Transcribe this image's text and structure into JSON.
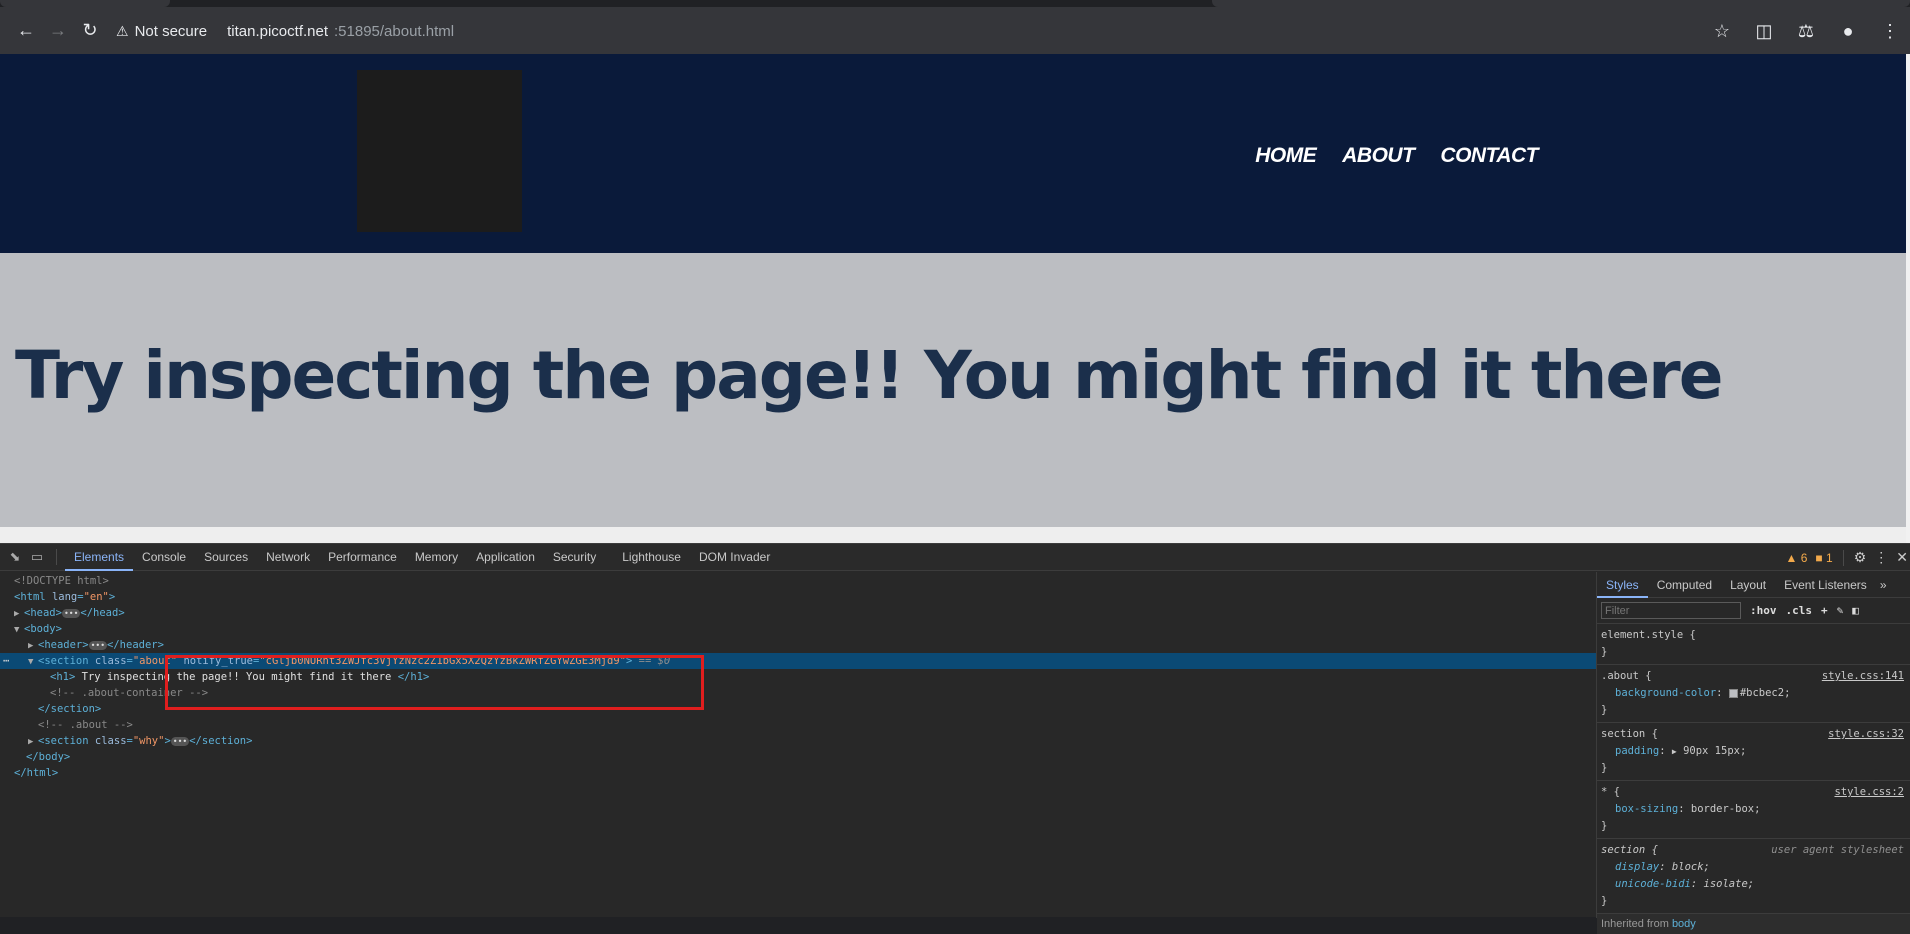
{
  "browser": {
    "security_label": "Not secure",
    "url_host": "titan.picoctf.net",
    "url_path": ":51895/about.html"
  },
  "site": {
    "nav": [
      "HOME",
      "ABOUT",
      "CONTACT"
    ],
    "heading": "Try inspecting the page!! You might find it there"
  },
  "devtools": {
    "tabs": [
      "Elements",
      "Console",
      "Sources",
      "Network",
      "Performance",
      "Memory",
      "Application",
      "Security",
      "Lighthouse",
      "DOM Invader"
    ],
    "warnings_count": "6",
    "issues_count": "1",
    "dom": {
      "doctype": "<!DOCTYPE html>",
      "html_open_tag": "<html",
      "html_lang_attr": "lang",
      "html_lang_val": "\"en\"",
      "head_open": "<head>",
      "head_close": "</head>",
      "body_open": "<body>",
      "header_open": "<header>",
      "header_close": "</header>",
      "section_open": "<section",
      "class_attr": "class",
      "about_val": "\"about\"",
      "notify_attr": "notify_true",
      "notify_val": "\"cGljb0NURnt3ZWJfc3VjYzNzc2Z1bGx5X2QzYzBkZWRfZGYwZGE3Mjd9\"",
      "tag_close": ">",
      "eq0": "== $0",
      "h1_open": "<h1>",
      "h1_text": " Try inspecting the page!! You might find it there ",
      "h1_close": "</h1>",
      "comment_container": "<!-- .about-container -->",
      "section_close": "</section>",
      "comment_about": "<!-- .about -->",
      "why_val": "\"why\"",
      "body_close": "</body>",
      "html_close": "</html>"
    },
    "styles": {
      "tabs": [
        "Styles",
        "Computed",
        "Layout",
        "Event Listeners"
      ],
      "filter_placeholder": "Filter",
      "hov": ":hov",
      "cls": ".cls",
      "rules": {
        "element_style": "element.style {",
        "about_selector": ".about {",
        "about_src": "style.css:141",
        "about_prop": "background-color",
        "about_value": "#bcbec2;",
        "section_selector": "section {",
        "section_src": "style.css:32",
        "section_prop": "padding",
        "section_value": "90px 15px;",
        "star_selector": "* {",
        "star_src": "style.css:2",
        "star_prop": "box-sizing",
        "star_value": "border-box;",
        "ua_selector": "section {",
        "ua_src": "user agent stylesheet",
        "ua_prop1": "display",
        "ua_value1": "block;",
        "ua_prop2": "unicode-bidi",
        "ua_value2": "isolate;",
        "close_brace": "}"
      },
      "inherited_label": "Inherited from",
      "inherited_tag": "body"
    }
  },
  "colors": {
    "header_bg": "#0a1a3a",
    "about_bg": "#bcbec2",
    "heading_color": "#1b2f4b",
    "highlight_box": "#e01e1e"
  }
}
